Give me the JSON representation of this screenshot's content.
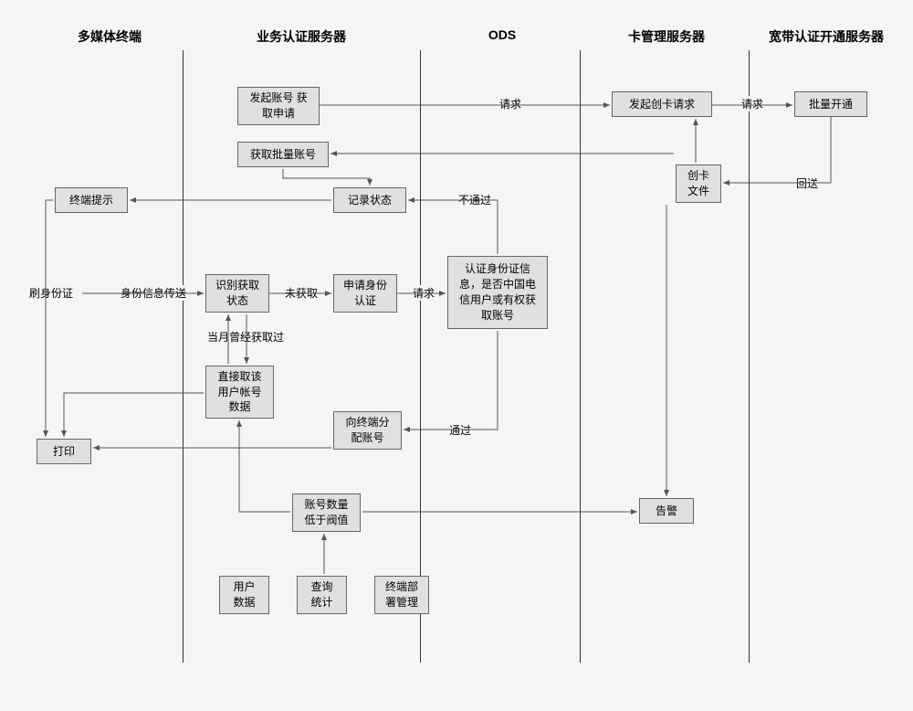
{
  "lanes": {
    "terminal": "多媒体终端",
    "biz_server": "业务认证服务器",
    "ods": "ODS",
    "card_server": "卡管理服务器",
    "bb_server": "宽带认证开通服务器"
  },
  "boxes": {
    "init_account_req": "发起账号\n获取申请",
    "get_batch_account": "获取批量账号",
    "record_status": "记录状态",
    "terminal_prompt": "终端提示",
    "init_card_req": "发起创卡请求",
    "batch_open": "批量开通",
    "card_file": "创卡\n文件",
    "swipe_id": "刷身份证",
    "recognize_status": "识别获取\n状态",
    "apply_id_auth": "申请身份\n认证",
    "auth_id_info": "认证身份证信\n息，是否中国电\n信用户或有权获\n取账号",
    "direct_fetch": "直接取该\n用户帐号\n数据",
    "assign_account": "向终端分\n配账号",
    "print": "打印",
    "account_below": "账号数量\n低于阀值",
    "user_data": "用户\n数据",
    "query_stats": "查询\n统计",
    "terminal_deploy": "终端部\n署管理",
    "alarm": "告警"
  },
  "labels": {
    "request1": "请求",
    "request2": "请求",
    "request3": "请求",
    "return": "回送",
    "not_pass": "不通过",
    "pass": "通过",
    "id_info_send": "身份信息传送",
    "not_obtained": "未获取",
    "obtained_this_month": "当月曾经获取过"
  },
  "chart_data": {
    "type": "swimlane-flowchart",
    "lanes": [
      "多媒体终端",
      "业务认证服务器",
      "ODS",
      "卡管理服务器",
      "宽带认证开通服务器"
    ],
    "nodes": [
      {
        "id": "init_account_req",
        "lane": "业务认证服务器",
        "label": "发起账号获取申请"
      },
      {
        "id": "get_batch_account",
        "lane": "业务认证服务器",
        "label": "获取批量账号"
      },
      {
        "id": "record_status",
        "lane": "业务认证服务器",
        "label": "记录状态"
      },
      {
        "id": "terminal_prompt",
        "lane": "多媒体终端",
        "label": "终端提示"
      },
      {
        "id": "init_card_req",
        "lane": "卡管理服务器",
        "label": "发起创卡请求"
      },
      {
        "id": "batch_open",
        "lane": "宽带认证开通服务器",
        "label": "批量开通"
      },
      {
        "id": "card_file",
        "lane": "卡管理服务器",
        "label": "创卡文件"
      },
      {
        "id": "swipe_id",
        "lane": "多媒体终端",
        "label": "刷身份证"
      },
      {
        "id": "recognize_status",
        "lane": "业务认证服务器",
        "label": "识别获取状态"
      },
      {
        "id": "apply_id_auth",
        "lane": "业务认证服务器",
        "label": "申请身份认证"
      },
      {
        "id": "auth_id_info",
        "lane": "ODS",
        "label": "认证身份证信息，是否中国电信用户或有权获取账号"
      },
      {
        "id": "direct_fetch",
        "lane": "业务认证服务器",
        "label": "直接取该用户帐号数据"
      },
      {
        "id": "assign_account",
        "lane": "业务认证服务器",
        "label": "向终端分配账号"
      },
      {
        "id": "print",
        "lane": "多媒体终端",
        "label": "打印"
      },
      {
        "id": "account_below",
        "lane": "业务认证服务器",
        "label": "账号数量低于阀值"
      },
      {
        "id": "user_data",
        "lane": "业务认证服务器",
        "label": "用户数据"
      },
      {
        "id": "query_stats",
        "lane": "业务认证服务器",
        "label": "查询统计"
      },
      {
        "id": "terminal_deploy",
        "lane": "业务认证服务器",
        "label": "终端部署管理"
      },
      {
        "id": "alarm",
        "lane": "卡管理服务器",
        "label": "告警"
      }
    ],
    "edges": [
      {
        "from": "init_account_req",
        "to": "init_card_req",
        "label": "请求"
      },
      {
        "from": "init_card_req",
        "to": "batch_open",
        "label": "请求"
      },
      {
        "from": "batch_open",
        "to": "card_file",
        "label": "回送"
      },
      {
        "from": "card_file",
        "to": "get_batch_account"
      },
      {
        "from": "card_file",
        "to": "init_card_req"
      },
      {
        "from": "get_batch_account",
        "to": "record_status"
      },
      {
        "from": "record_status",
        "to": "terminal_prompt"
      },
      {
        "from": "swipe_id",
        "to": "recognize_status",
        "label": "身份信息传送"
      },
      {
        "from": "recognize_status",
        "to": "apply_id_auth",
        "label": "未获取"
      },
      {
        "from": "apply_id_auth",
        "to": "auth_id_info",
        "label": "请求"
      },
      {
        "from": "auth_id_info",
        "to": "record_status",
        "label": "不通过"
      },
      {
        "from": "auth_id_info",
        "to": "assign_account",
        "label": "通过"
      },
      {
        "from": "recognize_status",
        "to": "direct_fetch",
        "label": "当月曾经获取过"
      },
      {
        "from": "direct_fetch",
        "to": "print"
      },
      {
        "from": "assign_account",
        "to": "print"
      },
      {
        "from": "terminal_prompt",
        "to": "print"
      },
      {
        "from": "account_below",
        "to": "alarm"
      },
      {
        "from": "account_below",
        "to": "direct_fetch"
      }
    ]
  }
}
